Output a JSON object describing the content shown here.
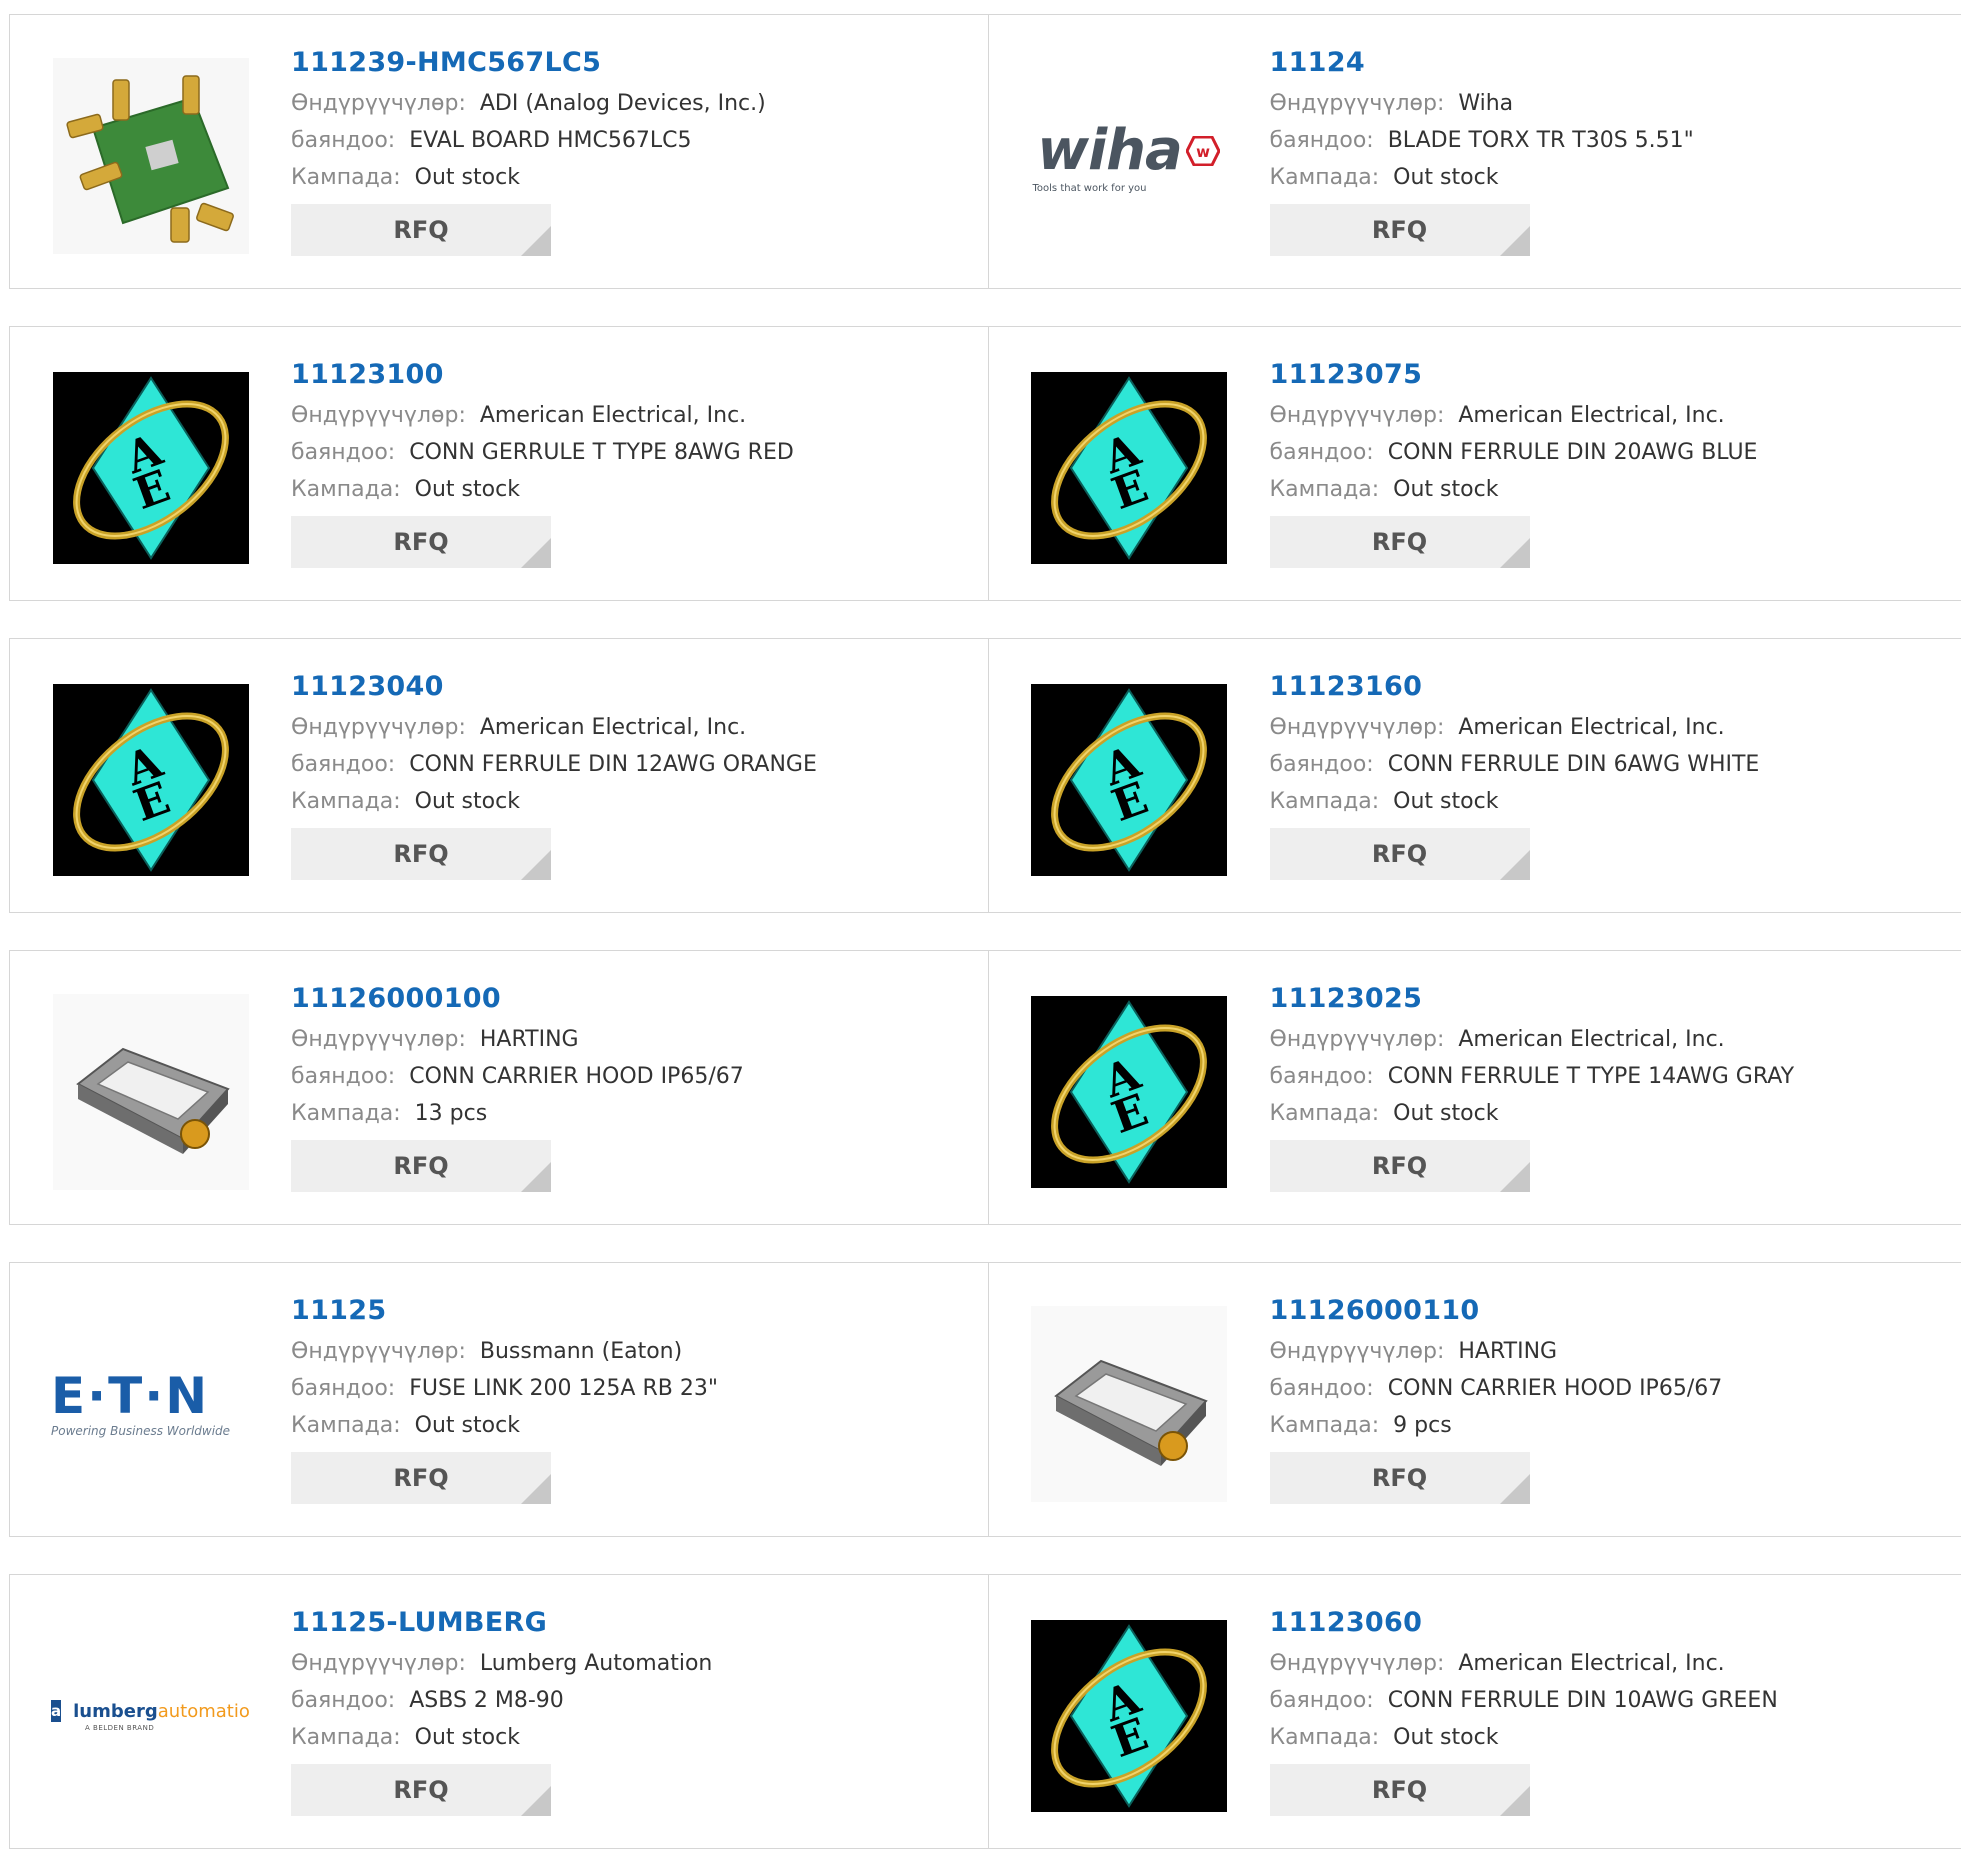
{
  "labels": {
    "manufacturer": "Өндүрүүчүлөр:",
    "description": "баяндоо:",
    "stock": "Кампада:",
    "rfq": "RFQ"
  },
  "logos": {
    "wiha_word": "wiha",
    "wiha_tagline": "Tools that work for you",
    "eaton_word": "E·T·N",
    "eaton_tagline": "Powering Business Worldwide",
    "lumberg_a": "lumberg",
    "lumberg_b": "automation",
    "lumberg_tagline": "A BELDEN BRAND"
  },
  "products": [
    {
      "part": "111239-HMC567LC5",
      "manufacturer": "ADI (Analog Devices, Inc.)",
      "description": "EVAL BOARD HMC567LC5",
      "stock": "Out stock",
      "image": "eval-board"
    },
    {
      "part": "11124",
      "manufacturer": "Wiha",
      "description": "BLADE TORX TR T30S 5.51\"",
      "stock": "Out stock",
      "image": "wiha-logo"
    },
    {
      "part": "11123100",
      "manufacturer": "American Electrical, Inc.",
      "description": "CONN GERRULE T TYPE 8AWG RED",
      "stock": "Out stock",
      "image": "ae-logo"
    },
    {
      "part": "11123075",
      "manufacturer": "American Electrical, Inc.",
      "description": "CONN FERRULE DIN 20AWG BLUE",
      "stock": "Out stock",
      "image": "ae-logo"
    },
    {
      "part": "11123040",
      "manufacturer": "American Electrical, Inc.",
      "description": "CONN FERRULE DIN 12AWG ORANGE",
      "stock": "Out stock",
      "image": "ae-logo"
    },
    {
      "part": "11123160",
      "manufacturer": "American Electrical, Inc.",
      "description": "CONN FERRULE DIN 6AWG WHITE",
      "stock": "Out stock",
      "image": "ae-logo"
    },
    {
      "part": "11126000100",
      "manufacturer": "HARTING",
      "description": "CONN CARRIER HOOD IP65/67",
      "stock": "13 pcs",
      "image": "carrier-hood"
    },
    {
      "part": "11123025",
      "manufacturer": "American Electrical, Inc.",
      "description": "CONN FERRULE T TYPE 14AWG GRAY",
      "stock": "Out stock",
      "image": "ae-logo"
    },
    {
      "part": "11125",
      "manufacturer": "Bussmann (Eaton)",
      "description": "FUSE LINK 200 125A RB 23\"",
      "stock": "Out stock",
      "image": "eaton-logo"
    },
    {
      "part": "11126000110",
      "manufacturer": "HARTING",
      "description": "CONN CARRIER HOOD IP65/67",
      "stock": "9 pcs",
      "image": "carrier-hood"
    },
    {
      "part": "11125-LUMBERG",
      "manufacturer": "Lumberg Automation",
      "description": "ASBS 2 M8-90",
      "stock": "Out stock",
      "image": "lumberg-logo"
    },
    {
      "part": "11123060",
      "manufacturer": "American Electrical, Inc.",
      "description": "CONN FERRULE DIN 10AWG GREEN",
      "stock": "Out stock",
      "image": "ae-logo"
    }
  ]
}
